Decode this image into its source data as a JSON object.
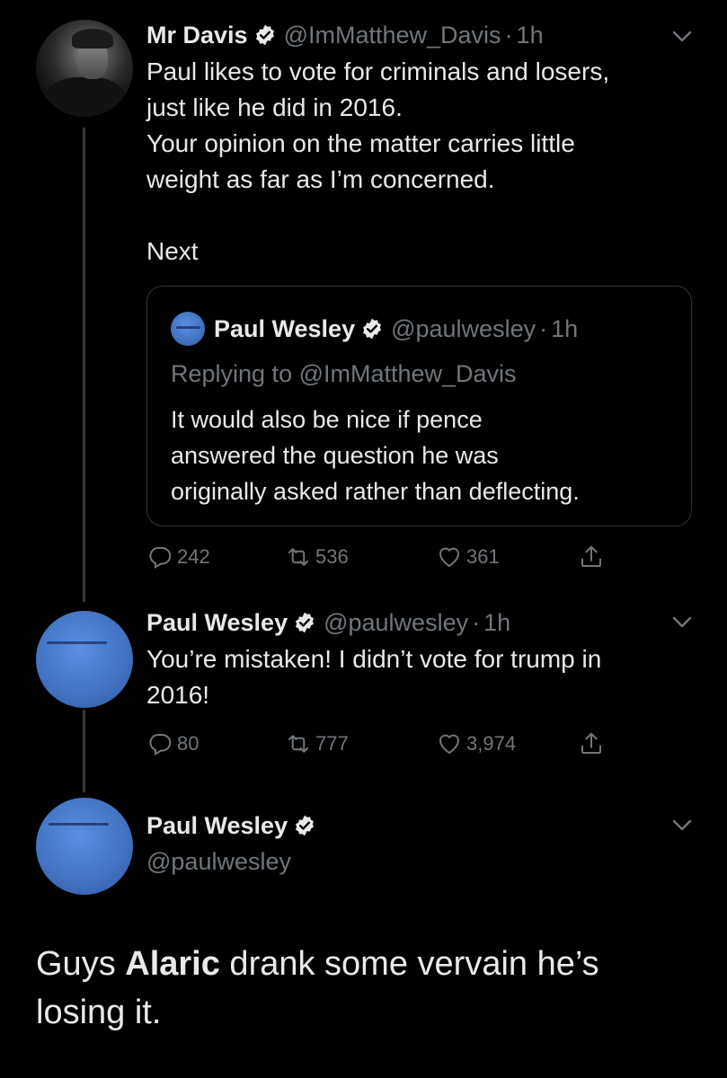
{
  "tweet1": {
    "name": "Mr Davis",
    "handle": "@ImMatthew_Davis",
    "time": "1h",
    "lines": [
      "Paul likes to vote for criminals and losers,",
      "just like he did in 2016.",
      "Your opinion on the matter carries little",
      "weight as far as I’m concerned."
    ],
    "extra": "Next",
    "quote": {
      "name": "Paul Wesley",
      "handle": "@paulwesley",
      "time": "1h",
      "replying": "Replying to @ImMatthew_Davis",
      "lines": [
        "It would also be nice if pence",
        "answered the question he was",
        "originally asked rather than deflecting."
      ]
    },
    "stats": {
      "replies": "242",
      "retweets": "536",
      "likes": "361"
    }
  },
  "tweet2": {
    "name": "Paul Wesley",
    "handle": "@paulwesley",
    "time": "1h",
    "lines": [
      "You’re mistaken! I didn’t vote for trump in",
      "2016!"
    ],
    "stats": {
      "replies": "80",
      "retweets": "777",
      "likes": "3,974"
    }
  },
  "tweet3": {
    "name": "Paul Wesley",
    "handle": "@paulwesley",
    "text_before": "Guys ",
    "text_bold": "Alaric",
    "text_after_line1": " drank some vervain he’s",
    "text_line2": "losing it."
  },
  "separator": "·",
  "colors": {
    "background": "#000000",
    "text": "#e7e9ea",
    "muted": "#71767b",
    "border": "#2f3336"
  }
}
